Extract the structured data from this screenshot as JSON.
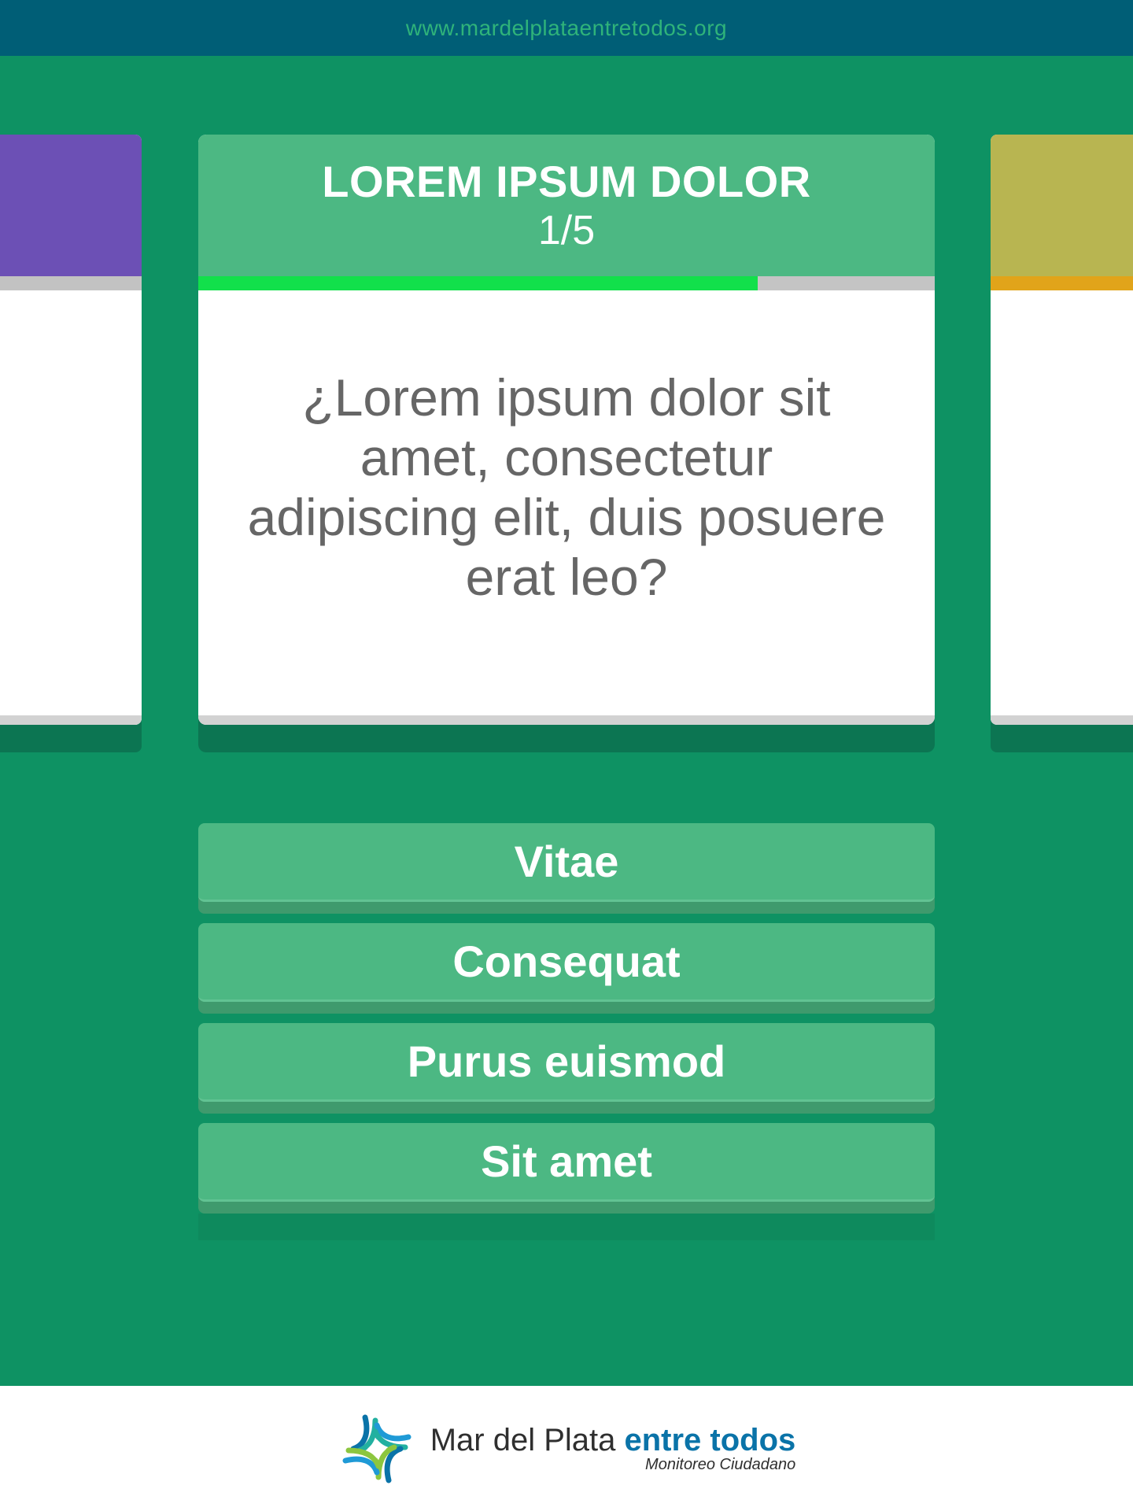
{
  "header": {
    "url": "www.mardelplataentretodos.org",
    "bg_color": "#005e76",
    "url_color": "#2fb37a"
  },
  "background_color": "#0e9263",
  "side_cards": {
    "left_color": "#6c50b5",
    "right_color": "#b8b551",
    "right_bar_color": "#e1a41a"
  },
  "question": {
    "title": "LOREM IPSUM DOLOR",
    "counter": "1/5",
    "progress": 0.76,
    "text": "¿Lorem ipsum dolor sit amet, consectetur adipiscing elit, duis posuere erat leo?",
    "header_color": "#4cb883",
    "progress_color": "#12e04b"
  },
  "answers": [
    {
      "label": "Vitae"
    },
    {
      "label": "Consequat"
    },
    {
      "label": "Purus euismod"
    },
    {
      "label": "Sit amet"
    }
  ],
  "footer": {
    "logo_name": "Mar del Plata ",
    "logo_accent": "entre todos",
    "logo_tagline": "Monitoreo Ciudadano",
    "logo_icon": "four-arrows-logo-icon",
    "accent_color": "#0a73a8"
  }
}
